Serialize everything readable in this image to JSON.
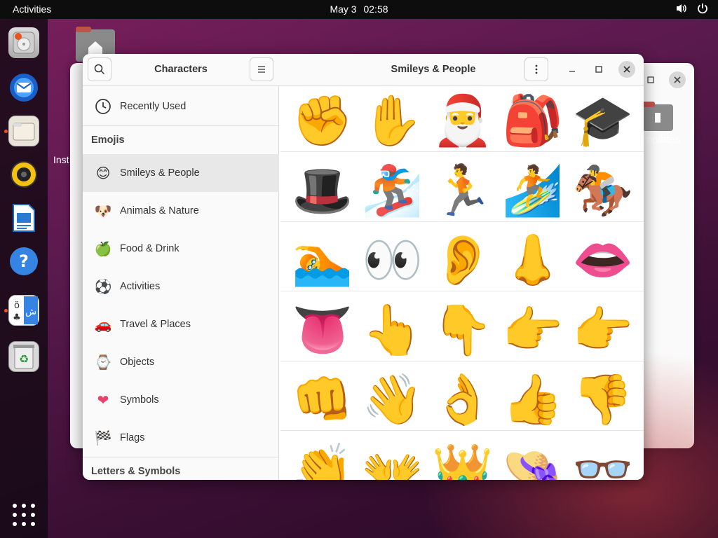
{
  "topbar": {
    "activities": "Activities",
    "date": "May 3",
    "time": "02:58"
  },
  "desktop": {
    "templates_label": "mplates",
    "install_label": "Inst"
  },
  "dock": {
    "items": [
      {
        "name": "installer",
        "icon": "disk-installer-icon"
      },
      {
        "name": "thunderbird",
        "icon": "mail-icon"
      },
      {
        "name": "files",
        "icon": "folder-icon"
      },
      {
        "name": "rhythmbox",
        "icon": "speaker-icon"
      },
      {
        "name": "writer",
        "icon": "document-icon"
      },
      {
        "name": "help",
        "icon": "help-icon"
      },
      {
        "name": "characters",
        "icon": "characters-icon"
      },
      {
        "name": "trash",
        "icon": "trash-icon"
      }
    ]
  },
  "sidebar": {
    "title": "Characters",
    "recently_used": "Recently Used",
    "emojis_heading": "Emojis",
    "categories": [
      {
        "label": "Smileys & People",
        "glyph": "😊"
      },
      {
        "label": "Animals & Nature",
        "glyph": "🐶"
      },
      {
        "label": "Food & Drink",
        "glyph": "🍏"
      },
      {
        "label": "Activities",
        "glyph": "⚽"
      },
      {
        "label": "Travel & Places",
        "glyph": "🚗"
      },
      {
        "label": "Objects",
        "glyph": "⌚"
      },
      {
        "label": "Symbols",
        "glyph": "❤"
      },
      {
        "label": "Flags",
        "glyph": "🏁"
      }
    ],
    "letters_heading": "Letters & Symbols"
  },
  "main": {
    "title": "Smileys & People",
    "emojis": [
      "✊",
      "✋",
      "🎅",
      "🎒",
      "🎓",
      "🎩",
      "🏂",
      "🏃",
      "🏄",
      "🏇",
      "🏊",
      "👀",
      "👂",
      "👃",
      "👄",
      "👅",
      "👆",
      "👇",
      "👉",
      "👉",
      "👊",
      "👋",
      "👌",
      "👍",
      "👎",
      "👏",
      "👐",
      "👑",
      "👒",
      "👓"
    ]
  },
  "colors": {
    "accent": "#e95420",
    "selected_row": "#e8e8e8",
    "topbar": "#0d0d0d"
  }
}
